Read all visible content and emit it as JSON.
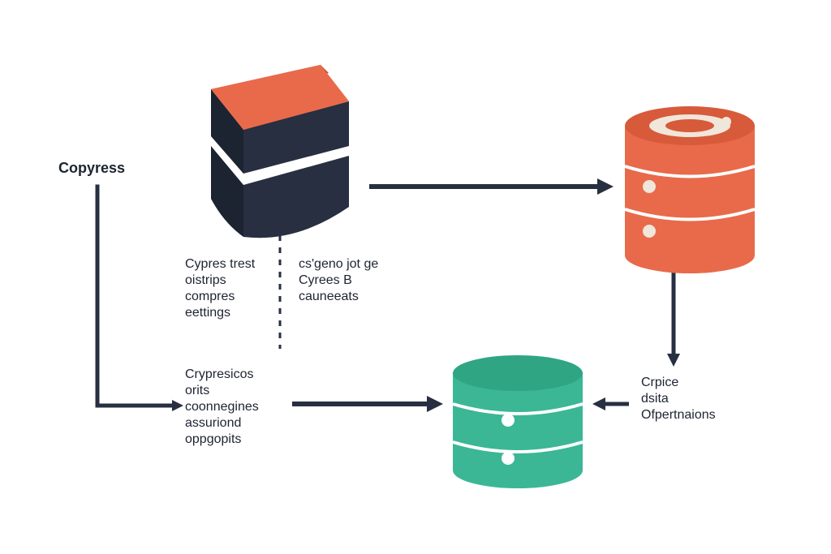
{
  "colors": {
    "orange": "#e96a4a",
    "orange_dark": "#d75a3a",
    "orange_top_edge": "#b84a30",
    "orange_highlight": "#f0e6da",
    "navy": "#272f40",
    "navy_light": "#3b4458",
    "green": "#3bb795",
    "green_dark": "#2fa584",
    "line": "#272f40"
  },
  "labels": {
    "copyress": "Copyress",
    "block_left": "Cypres trest\noistrips\ncompres\neettings",
    "block_right": "cs'geno jot ge\nCyrees B\ncauneeats",
    "assuriond": "Crypresicos\norits\ncoonnegines\nassuriond\noppgopits",
    "opertations": "Crpice\ndsita\nOfpertnaions"
  }
}
